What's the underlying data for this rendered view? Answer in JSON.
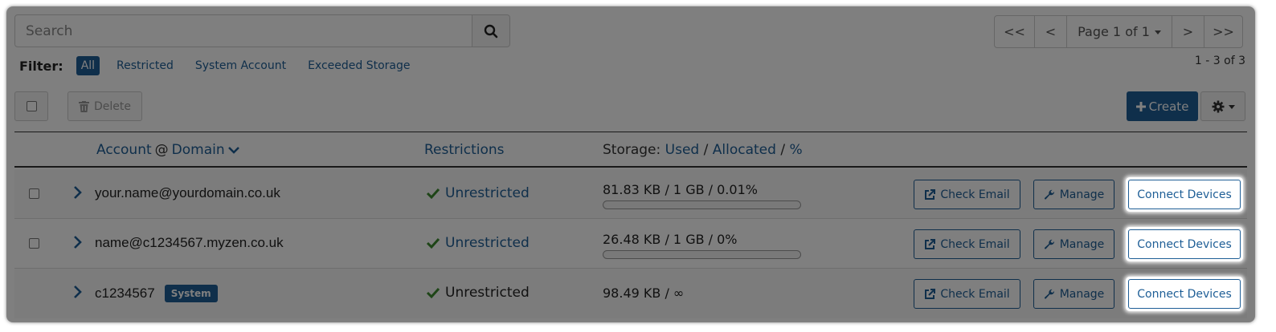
{
  "search": {
    "placeholder": "Search",
    "icon": "search-icon"
  },
  "pager": {
    "first": "<<",
    "prev": "<",
    "page_label": "Page 1 of 1",
    "next": ">",
    "last": ">>"
  },
  "result_count": "1 - 3 of 3",
  "filter": {
    "label": "Filter:",
    "options": [
      "All",
      "Restricted",
      "System Account",
      "Exceeded Storage"
    ],
    "active": "All"
  },
  "toolbar": {
    "delete_label": "Delete",
    "create_label": "Create"
  },
  "table": {
    "headers": {
      "account": "Account",
      "at": "@",
      "domain": "Domain",
      "restrictions": "Restrictions",
      "storage_prefix": "Storage:",
      "used": "Used",
      "allocated": "Allocated",
      "percent": "%",
      "sep": "/"
    },
    "rows": [
      {
        "account": "your.name@yourdomain.co.uk",
        "badge": "",
        "restriction": "Unrestricted",
        "storage": "81.83 KB / 1 GB / 0.01%",
        "usage_fraction": 0.0001,
        "has_checkbox": true,
        "has_bar": true
      },
      {
        "account": "name@c1234567.myzen.co.uk",
        "badge": "",
        "restriction": "Unrestricted",
        "storage": "26.48 KB / 1 GB / 0%",
        "usage_fraction": 0,
        "has_checkbox": true,
        "has_bar": true
      },
      {
        "account": "c1234567",
        "badge": "System",
        "restriction": "Unrestricted",
        "storage": "98.49 KB / ∞",
        "usage_fraction": null,
        "has_checkbox": false,
        "has_bar": false
      }
    ],
    "actions": {
      "check_email": "Check Email",
      "manage": "Manage",
      "connect_devices": "Connect Devices"
    }
  },
  "colors": {
    "accent": "#1e5e96",
    "success": "#3c8a2e"
  }
}
